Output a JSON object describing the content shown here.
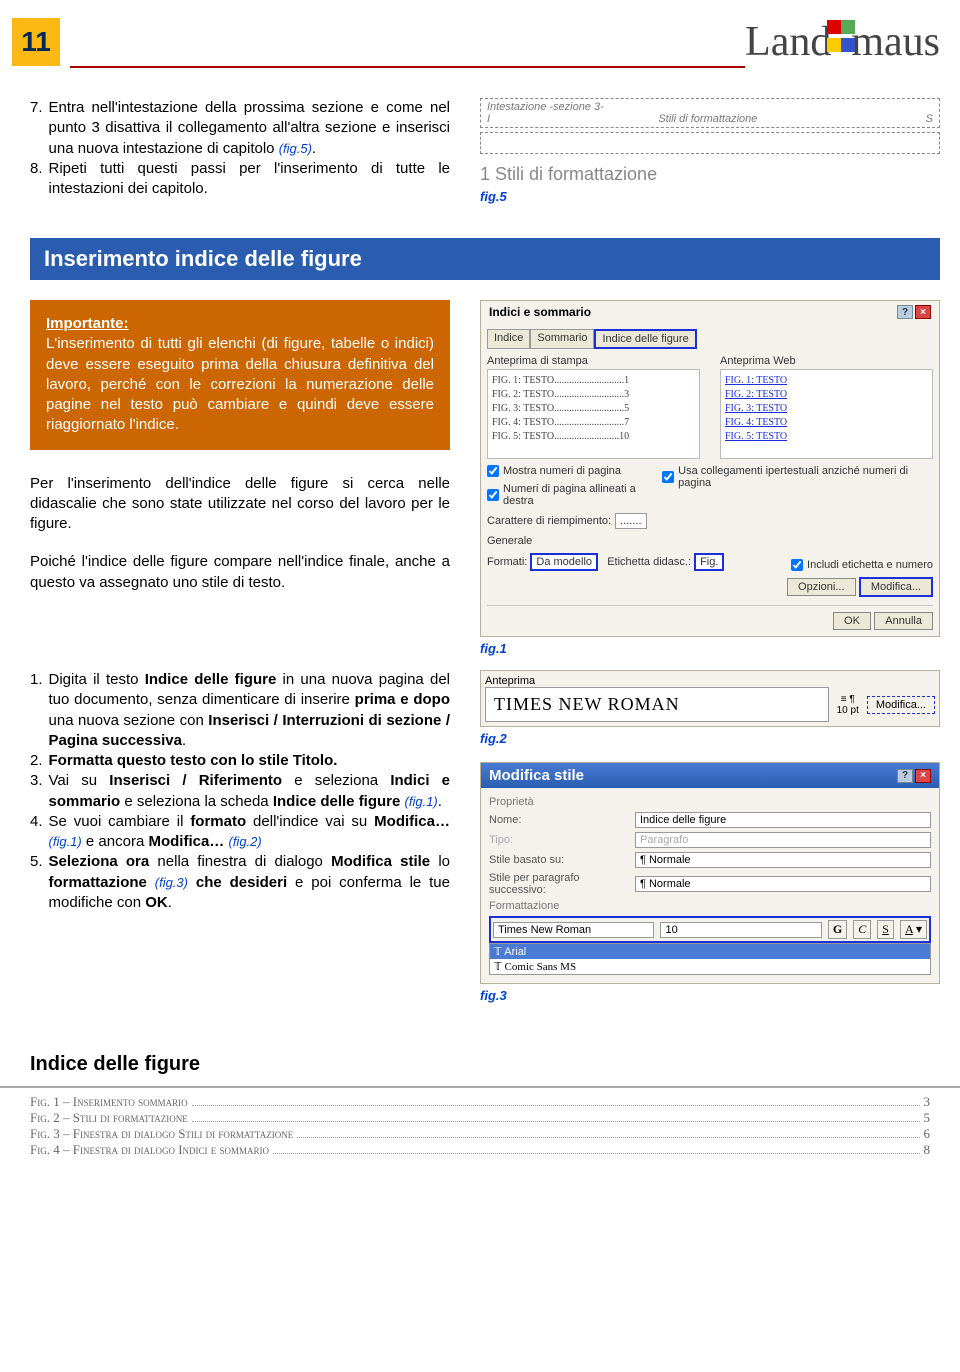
{
  "header": {
    "page_number": "11",
    "logo_left": "Land",
    "logo_right": "maus"
  },
  "top": {
    "item7": "Entra nell'intestazione della prossima sezione e come nel punto 3 disattiva il collegamento all'altra sezione e inserisci una nuova intestazione di capitolo",
    "item7_ref": "(fig.5)",
    "item7_tail": ".",
    "item8": "Ripeti tutti questi passi per l'inserimento di tutte le intestazioni dei capitolo.",
    "fig5_label": "fig.5",
    "mock5": {
      "headline": "Intestazione -sezione 3-",
      "i": "I",
      "s": "S",
      "stili": "Stili di formattazione",
      "body": "1  Stili di formattazione"
    }
  },
  "section_bar": "Inserimento indice delle figure",
  "important": {
    "heading": "Importante:",
    "text": "L'inserimento di tutti gli elenchi (di figure, tabelle o indici) deve essere eseguito prima della chiusura definitiva del lavoro, perché con le correzioni la numerazione delle pagine nel testo può cambiare e quindi deve essere riaggiornato l'indice."
  },
  "para1": "Per l'inserimento dell'indice delle figure si cerca nelle didascalie che sono state utilizzate nel corso del lavoro per le figure.",
  "para2": "Poiché l'indice delle figure compare nell'indice finale, anche a questo va assegnato uno stile di testo.",
  "fig1_label": "fig.1",
  "steps": {
    "s1a": "Digita il testo ",
    "s1b": "Indice delle figure",
    "s1c": " in una nuova pagina del tuo documento, senza dimenticare di inserire ",
    "s1d": "prima e dopo",
    "s1e": " una nuova sezione con ",
    "s1f": "Inserisci / Interruzioni di sezione / Pagina successiva",
    "s1g": ".",
    "s2a": "Formatta questo testo con lo stile Titolo.",
    "s3a": "Vai su ",
    "s3b": "Inserisci / Riferimento",
    "s3c": " e seleziona ",
    "s3d": "Indici e sommario",
    "s3e": " e seleziona la scheda ",
    "s3f": "Indice delle figure",
    "s3g": " ",
    "s3ref": "(fig.1)",
    "s3h": ".",
    "s4a": "Se vuoi cambiare il ",
    "s4b": "formato",
    "s4c": " dell'indice vai su ",
    "s4d": "Modifica…",
    "s4ref1": "(fig.1)",
    "s4e": " e ancora ",
    "s4f": "Modifica…",
    "s4ref2": "(fig.2)",
    "s5a": "Seleziona ora ",
    "s5b": "nella finestra di dialogo ",
    "s5c": "Modifica stile",
    "s5d": " lo ",
    "s5e": "formattazione",
    "s5ref": "(fig.3)",
    "s5f": " che desideri ",
    "s5g": "e poi conferma le tue modifiche con ",
    "s5h": "OK",
    "s5i": "."
  },
  "fig2_label": "fig.2",
  "fig3_label": "fig.3",
  "mock_toc": {
    "title": "Indici e sommario",
    "tabs": [
      "Indice",
      "Sommario",
      "Indice delle figure"
    ],
    "print_label": "Anteprima di stampa",
    "web_label": "Anteprima Web",
    "print_lines": [
      "FIG. 1: TESTO............................1",
      "FIG. 2: TESTO............................3",
      "FIG. 3: TESTO............................5",
      "FIG. 4: TESTO............................7",
      "FIG. 5: TESTO..........................10"
    ],
    "web_lines": [
      "FIG. 1: TESTO",
      "FIG. 2: TESTO",
      "FIG. 3: TESTO",
      "FIG. 4: TESTO",
      "FIG. 5: TESTO"
    ],
    "chk1": "Mostra numeri di pagina",
    "chk2": "Numeri di pagina allineati a destra",
    "chk3": "Usa collegamenti ipertestuali anziché numeri di pagina",
    "carattere": "Carattere di riempimento:",
    "dots": ".......",
    "generale": "Generale",
    "formati": "Formati:",
    "formati_val": "Da modello",
    "etichetta": "Etichetta didasc.:",
    "etichetta_val": "Fig.",
    "chk4": "Includi etichetta e numero",
    "opzioni": "Opzioni...",
    "modifica": "Modifica...",
    "ok": "OK",
    "annulla": "Annulla"
  },
  "mock_anteprima": {
    "label": "Anteprima",
    "sample": "TIMES NEW ROMAN",
    "pt": "10 pt",
    "modifica": "Modifica..."
  },
  "mock_modify": {
    "title": "Modifica stile",
    "proprieta": "Proprietà",
    "nome": "Nome:",
    "nome_val": "Indice delle figure",
    "tipo": "Tipo:",
    "tipo_val": "Paragrafo",
    "basato": "Stile basato su:",
    "basato_val": "¶ Normale",
    "succ": "Stile per paragrafo successivo:",
    "succ_val": "¶ Normale",
    "formattazione": "Formattazione",
    "font_sel": "Times New Roman",
    "font_opts": [
      "Arial",
      "Comic Sans MS"
    ],
    "size": "10",
    "g": "G",
    "c": "C",
    "s": "S",
    "a": "A"
  },
  "indice_out": {
    "title": "Indice delle figure",
    "rows": [
      {
        "t": "Fig. 1 – Inserimento sommario",
        "p": "3"
      },
      {
        "t": "Fig. 2 – Stili di formattazione",
        "p": "5"
      },
      {
        "t": "Fig. 3 – Finestra di dialogo Stili di formattazione",
        "p": "6"
      },
      {
        "t": "Fig. 4 – Finestra di dialogo Indici e sommario",
        "p": "8"
      }
    ]
  }
}
